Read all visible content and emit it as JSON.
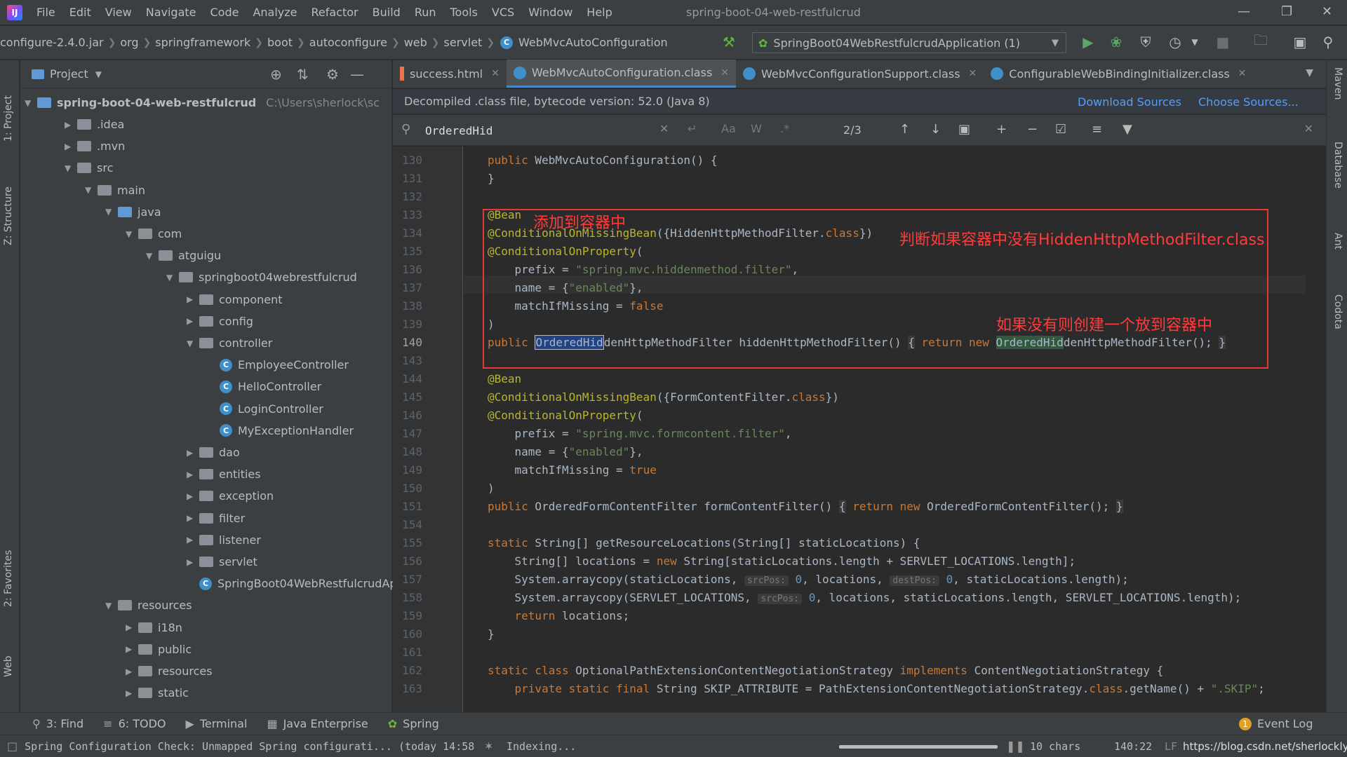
{
  "window": {
    "title": "spring-boot-04-web-restfulcrud"
  },
  "menu": [
    "File",
    "Edit",
    "View",
    "Navigate",
    "Code",
    "Analyze",
    "Refactor",
    "Build",
    "Run",
    "Tools",
    "VCS",
    "Window",
    "Help"
  ],
  "breadcrumbs": [
    "configure-2.4.0.jar",
    "org",
    "springframework",
    "boot",
    "autoconfigure",
    "web",
    "servlet",
    "WebMvcAutoConfiguration"
  ],
  "run_config": "SpringBoot04WebRestfulcrudApplication (1)",
  "left_strip": {
    "project": "1: Project",
    "structure": "Z: Structure",
    "favorites": "2: Favorites",
    "web": "Web"
  },
  "right_strip": {
    "maven": "Maven",
    "database": "Database",
    "ant": "Ant",
    "codota": "Codota"
  },
  "project": {
    "title": "Project",
    "root": "spring-boot-04-web-restfulcrud",
    "root_path": "C:\\Users\\sherlock\\sc",
    "items": [
      {
        "label": ".idea",
        "type": "folder",
        "expanded": false
      },
      {
        "label": ".mvn",
        "type": "folder",
        "expanded": false
      },
      {
        "label": "src",
        "type": "folder",
        "expanded": true
      },
      {
        "label": "main",
        "type": "folder",
        "expanded": true
      },
      {
        "label": "java",
        "type": "folder-blue",
        "expanded": true
      },
      {
        "label": "com",
        "type": "folder",
        "expanded": true
      },
      {
        "label": "atguigu",
        "type": "folder",
        "expanded": true
      },
      {
        "label": "springboot04webrestfulcrud",
        "type": "folder",
        "expanded": true
      },
      {
        "label": "component",
        "type": "folder",
        "expanded": false
      },
      {
        "label": "config",
        "type": "folder",
        "expanded": false
      },
      {
        "label": "controller",
        "type": "folder",
        "expanded": true
      },
      {
        "label": "EmployeeController",
        "type": "class"
      },
      {
        "label": "HelloController",
        "type": "class"
      },
      {
        "label": "LoginController",
        "type": "class"
      },
      {
        "label": "MyExceptionHandler",
        "type": "class"
      },
      {
        "label": "dao",
        "type": "folder",
        "expanded": false
      },
      {
        "label": "entities",
        "type": "folder",
        "expanded": false
      },
      {
        "label": "exception",
        "type": "folder",
        "expanded": false
      },
      {
        "label": "filter",
        "type": "folder",
        "expanded": false
      },
      {
        "label": "listener",
        "type": "folder",
        "expanded": false
      },
      {
        "label": "servlet",
        "type": "folder",
        "expanded": false
      },
      {
        "label": "SpringBoot04WebRestfulcrudApp",
        "type": "class"
      },
      {
        "label": "resources",
        "type": "folder",
        "expanded": true
      },
      {
        "label": "i18n",
        "type": "folder",
        "expanded": false
      },
      {
        "label": "public",
        "type": "folder",
        "expanded": false
      },
      {
        "label": "resources",
        "type": "folder",
        "expanded": false
      },
      {
        "label": "static",
        "type": "folder",
        "expanded": false
      }
    ]
  },
  "tabs": [
    {
      "label": "success.html",
      "active": false
    },
    {
      "label": "WebMvcAutoConfiguration.class",
      "active": true
    },
    {
      "label": "WebMvcConfigurationSupport.class",
      "active": false
    },
    {
      "label": "ConfigurableWebBindingInitializer.class",
      "active": false
    }
  ],
  "banner": {
    "text": "Decompiled .class file, bytecode version: 52.0 (Java 8)",
    "download": "Download Sources",
    "choose": "Choose Sources..."
  },
  "search": {
    "value": "OrderedHid",
    "count": "2/3"
  },
  "line_numbers": [
    "130",
    "131",
    "132",
    "133",
    "134",
    "135",
    "136",
    "137",
    "138",
    "139",
    "140",
    "143",
    "144",
    "145",
    "146",
    "147",
    "148",
    "149",
    "150",
    "151",
    "154",
    "155",
    "156",
    "157",
    "158",
    "159",
    "160",
    "161",
    "162",
    "163"
  ],
  "annotations": {
    "add_to_container": "添加到容器中",
    "check_missing": "判断如果容器中没有HiddenHttpMethodFilter.class",
    "create_if_missing": "如果没有则创建一个放到容器中"
  },
  "bottom_tools": [
    "3: Find",
    "6: TODO",
    "Terminal",
    "Java Enterprise",
    "Spring"
  ],
  "event_log": {
    "label": "Event Log",
    "count": "1"
  },
  "status": {
    "message": "Spring Configuration Check: Unmapped Spring configurati... (today 14:58",
    "indexing": "Indexing...",
    "chars": "10 chars",
    "position": "140:22",
    "line_sep": "LF",
    "watermark": "https://blog.csdn.net/sherlockly"
  },
  "colors": {
    "accent": "#4a88c7",
    "note_red": "#ff3b3b",
    "keyword": "#cc7832",
    "string": "#6a8759"
  }
}
